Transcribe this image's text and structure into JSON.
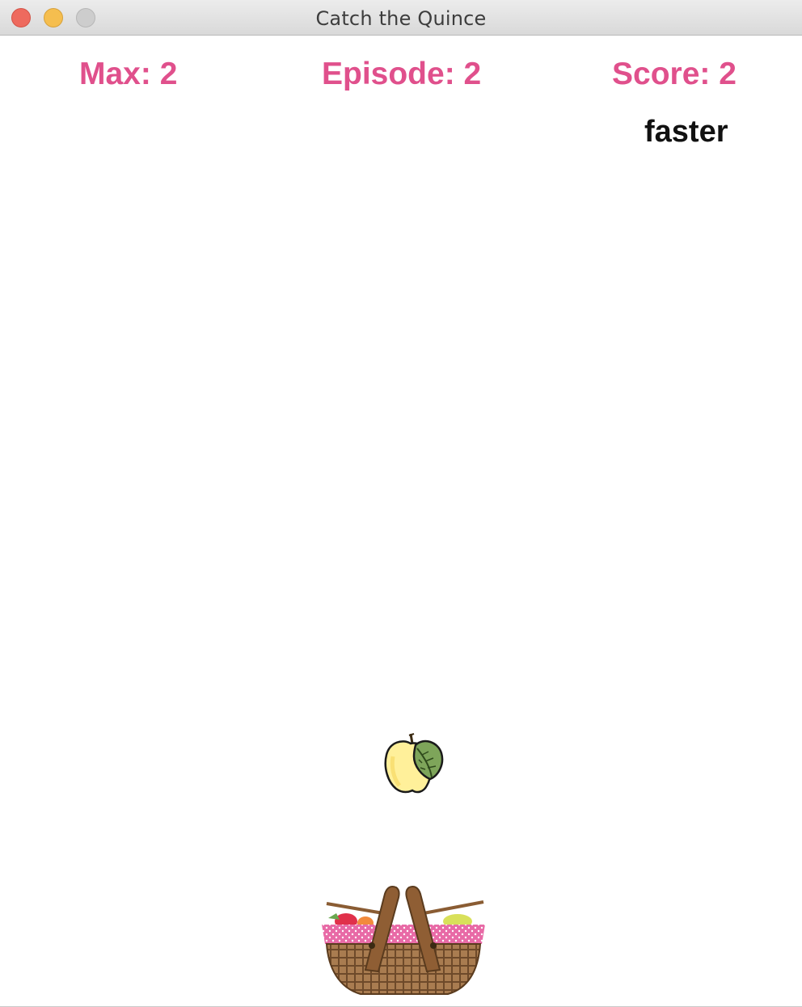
{
  "window": {
    "title": "Catch the Quince"
  },
  "hud": {
    "max": "Max: 2",
    "episode": "Episode: 2",
    "score": "Score: 2",
    "speed": "faster"
  },
  "colors": {
    "hud_text": "#e0508c",
    "speed_text": "#111111",
    "background": "#ffffff"
  },
  "sprites": {
    "falling": "quince-icon",
    "catcher": "basket-icon"
  }
}
